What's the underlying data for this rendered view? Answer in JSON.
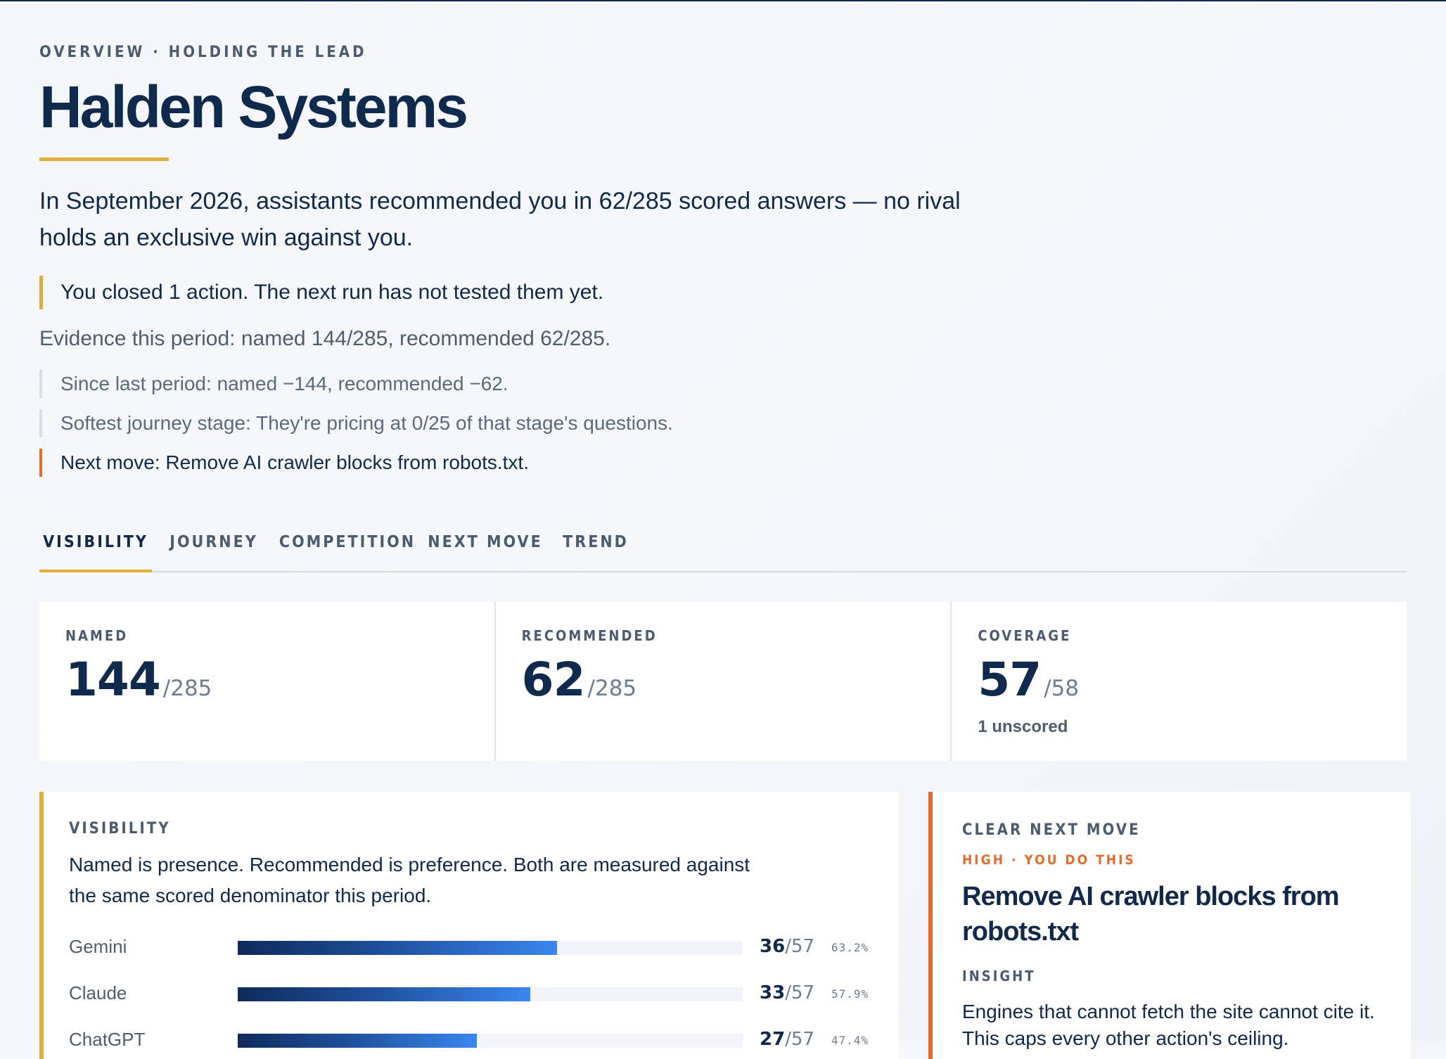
{
  "header": {
    "eyebrow": "OVERVIEW · HOLDING THE LEAD",
    "title": "Halden Systems",
    "lede": "In September 2026, assistants recommended you in 62/285 scored answers — no rival holds an exclusive win against you.",
    "callout": "You closed 1 action. The next run has not tested them yet.",
    "evidence": "Evidence this period: named 144/285, recommended 62/285.",
    "notes": [
      "Since last period: named −144, recommended −62.",
      "Softest journey stage: They're pricing at 0/25 of that stage's questions.",
      "Next move: Remove AI crawler blocks from robots.txt."
    ]
  },
  "tabs": [
    "VISIBILITY",
    "JOURNEY",
    "COMPETITION",
    "NEXT MOVE",
    "TREND"
  ],
  "stats": [
    {
      "label": "NAMED",
      "value": "144",
      "denominator": "/285",
      "sub": ""
    },
    {
      "label": "RECOMMENDED",
      "value": "62",
      "denominator": "/285",
      "sub": ""
    },
    {
      "label": "COVERAGE",
      "value": "57",
      "denominator": "/58",
      "sub": "1 unscored"
    }
  ],
  "visibility_panel": {
    "eyebrow": "VISIBILITY",
    "description": "Named is presence. Recommended is preference. Both are measured against the same scored denominator this period.",
    "rows": [
      {
        "name": "Gemini",
        "count": "36",
        "total": "/57",
        "pct": "63.2%",
        "fraction": 0.632
      },
      {
        "name": "Claude",
        "count": "33",
        "total": "/57",
        "pct": "57.9%",
        "fraction": 0.579
      },
      {
        "name": "ChatGPT",
        "count": "27",
        "total": "/57",
        "pct": "47.4%",
        "fraction": 0.474
      }
    ]
  },
  "next_move_panel": {
    "eyebrow": "CLEAR NEXT MOVE",
    "priority": "HIGH · YOU DO THIS",
    "title": "Remove AI crawler blocks from robots.txt",
    "insight_label": "INSIGHT",
    "insight": "Engines that cannot fetch the site cannot cite it. This caps every other action's ceiling."
  },
  "colors": {
    "accent_gold": "#e0ae3a",
    "accent_orange": "#e46b2a",
    "navy": "#0f2a4d"
  }
}
